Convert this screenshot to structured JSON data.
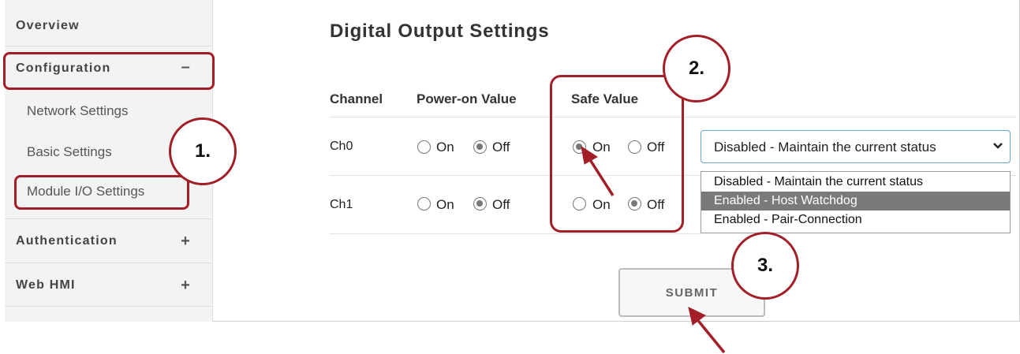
{
  "sidebar": {
    "overview": "Overview",
    "configuration": {
      "label": "Configuration",
      "toggle": "–"
    },
    "sub_items": [
      "Network Settings",
      "Basic Settings",
      "Module I/O Settings"
    ],
    "authentication": {
      "label": "Authentication",
      "toggle": "+"
    },
    "web_hmi": {
      "label": "Web HMI",
      "toggle": "+"
    }
  },
  "main": {
    "title": "Digital Output Settings",
    "columns": [
      "Channel",
      "Power-on Value",
      "Safe Value"
    ],
    "rows": [
      {
        "channel": "Ch0",
        "power_on": "off",
        "safe": "on"
      },
      {
        "channel": "Ch1",
        "power_on": "off",
        "safe": "off"
      }
    ],
    "on_label": "On",
    "off_label": "Off",
    "select_value": "Disabled - Maintain the current status",
    "options": [
      "Disabled - Maintain the current status",
      "Enabled - Host Watchdog",
      "Enabled - Pair-Connection"
    ],
    "highlighted_option": "Enabled - Host Watchdog",
    "submit_label": "SUBMIT"
  },
  "annotations": {
    "step1": "1.",
    "step2": "2.",
    "step3": "3.",
    "color": "#a31f28"
  }
}
